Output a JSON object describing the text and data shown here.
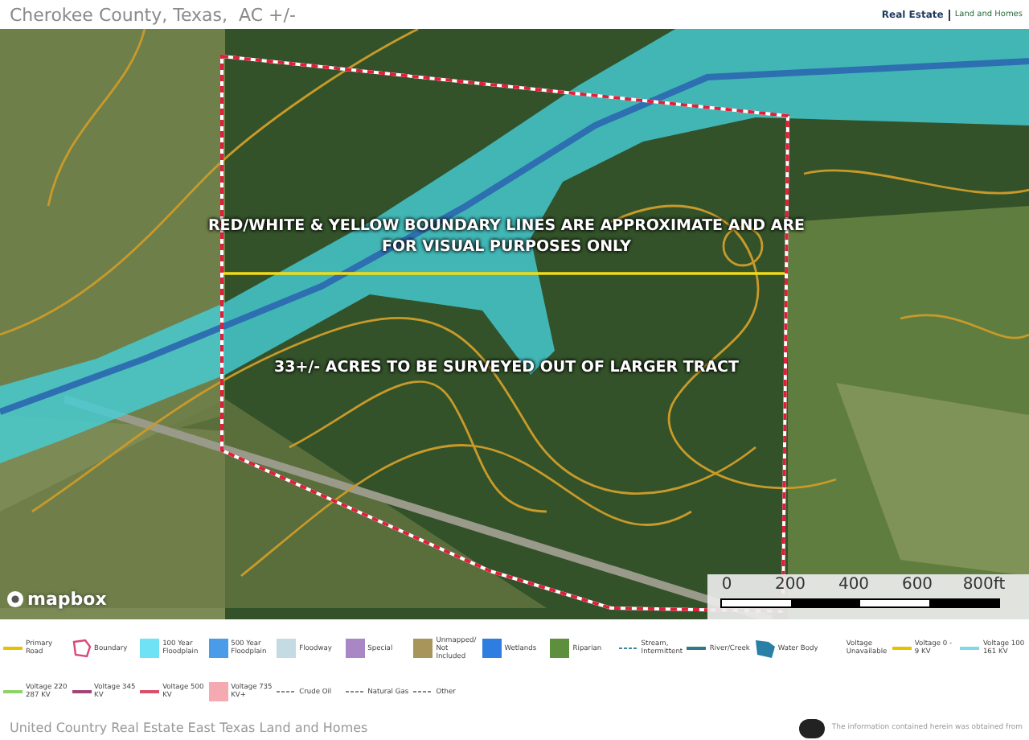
{
  "header": {
    "title": "Cherokee County, Texas,  AC +/-",
    "logo_text": "Real Estate",
    "logo_subtext": "Land and Homes"
  },
  "map": {
    "annotations": [
      {
        "text": "RED/WHITE & YELLOW BOUNDARY LINES ARE APPROXIMATE AND ARE FOR VISUAL PURPOSES ONLY"
      },
      {
        "text": "33+/- ACRES TO BE SURVEYED OUT OF LARGER TRACT"
      }
    ],
    "attribution": "mapbox",
    "scale_labels": [
      "0",
      "200",
      "400",
      "600",
      "800ft"
    ]
  },
  "legend": [
    {
      "label": "Primary Road",
      "kind": "line",
      "color": "#e6c200"
    },
    {
      "label": "Boundary",
      "kind": "polygon",
      "color": "#d9487a"
    },
    {
      "label": "100 Year Floodplain",
      "kind": "swatch",
      "color": "#6fe3f5"
    },
    {
      "label": "500 Year Floodplain",
      "kind": "swatch",
      "color": "#4a9be8"
    },
    {
      "label": "Floodway",
      "kind": "swatch",
      "color": "#c4dbe4"
    },
    {
      "label": "Special",
      "kind": "swatch",
      "color": "#a887c4"
    },
    {
      "label": "Unmapped/ Not Included",
      "kind": "swatch",
      "color": "#a8955a"
    },
    {
      "label": "Wetlands",
      "kind": "swatch",
      "color": "#2f7de0"
    },
    {
      "label": "Riparian",
      "kind": "swatch",
      "color": "#5d8f3c"
    },
    {
      "label": "Stream, Intermittent",
      "kind": "dashed",
      "color": "#3b8a99"
    },
    {
      "label": "River/Creek",
      "kind": "line",
      "color": "#2f7a8a"
    },
    {
      "label": "Water Body",
      "kind": "area",
      "color": "#2a7fa6"
    },
    {
      "label": "Voltage Unavailable",
      "kind": "none"
    },
    {
      "label": "Voltage 0 - 9 KV",
      "kind": "line",
      "color": "#e6c200"
    },
    {
      "label": "Voltage 100 161 KV",
      "kind": "line",
      "color": "#7fd9e8"
    },
    {
      "label": "Voltage 220 287 KV",
      "kind": "line",
      "color": "#8fd16a"
    },
    {
      "label": "Voltage 345 KV",
      "kind": "line",
      "color": "#a0457a"
    },
    {
      "label": "Voltage 500 KV",
      "kind": "line",
      "color": "#d9506a"
    },
    {
      "label": "Voltage 735 KV+",
      "kind": "swatch",
      "color": "#f5a9b0"
    },
    {
      "label": "Crude Oil",
      "kind": "dashed",
      "color": "#888888"
    },
    {
      "label": "Natural Gas",
      "kind": "dashed",
      "color": "#888888"
    },
    {
      "label": "Other",
      "kind": "dashed",
      "color": "#888888"
    }
  ],
  "footer": {
    "company": "United Country Real Estate East Texas Land and Homes",
    "disclaimer": "The information contained herein was obtained from"
  }
}
